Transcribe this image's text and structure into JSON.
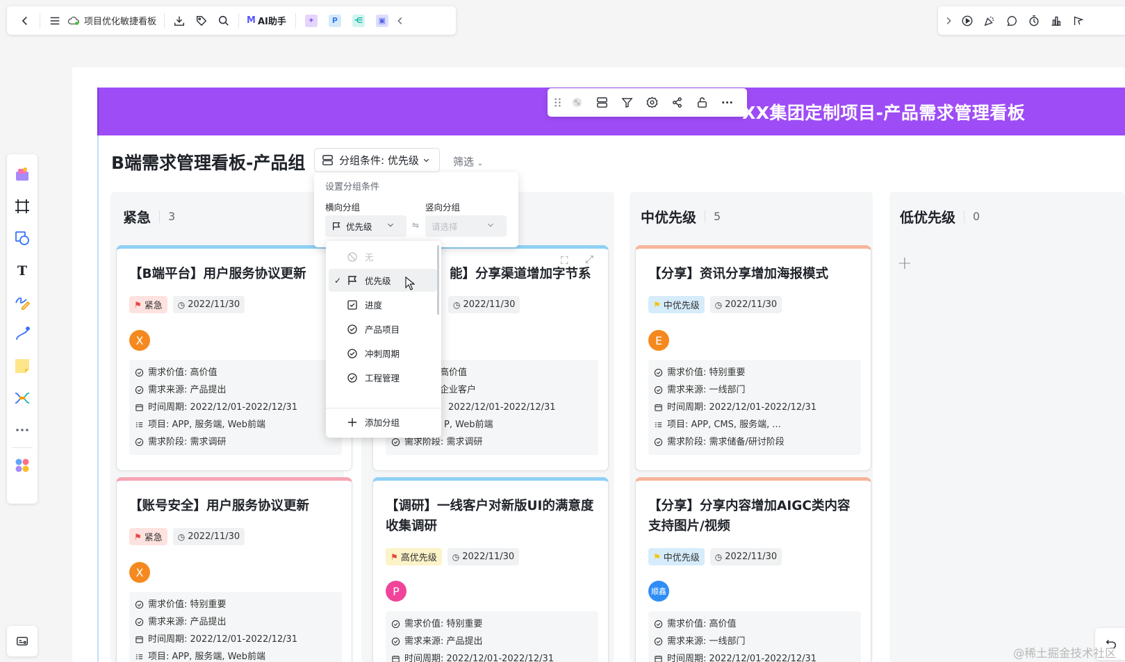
{
  "toolbar": {
    "doc_title": "项目优化敏捷看板",
    "ai_label": "AI助手"
  },
  "banner": {
    "title": "XX集团定制项目-产品需求管理看板"
  },
  "board": {
    "title": "B端需求管理看板-产品组",
    "group_label": "分组条件: 优先级",
    "filter_label": "筛选"
  },
  "group_dropdown": {
    "header": "设置分组条件",
    "horizontal_label": "横向分组",
    "vertical_label": "竖向分组",
    "horizontal_value": "优先级",
    "vertical_placeholder": "请选择"
  },
  "menu": {
    "items": [
      "无",
      "优先级",
      "进度",
      "产品项目",
      "冲刺周期",
      "工程管理"
    ],
    "add_label": "添加分组"
  },
  "columns": [
    {
      "title": "紧急",
      "count": "3"
    },
    {
      "title": "中优先级",
      "count": "5"
    },
    {
      "title": "低优先级",
      "count": "0"
    }
  ],
  "cards": [
    {
      "title": "【B端平台】用户服务协议更新",
      "priority": "紧急",
      "date": "2022/11/30",
      "avatar": "X",
      "props": [
        "需求价值: 高价值",
        "需求来源: 产品提出",
        "时间周期: 2022/12/01-2022/12/31",
        "项目: APP, 服务端, Web前端",
        "需求阶段: 需求调研"
      ]
    },
    {
      "title": "能】分享渠道增加字节系",
      "date": "2022/11/30",
      "props": [
        "高价值",
        "企业客户",
        "2022/12/01-2022/12/31",
        "P, Web前端",
        "需求阶段: 需求调研"
      ]
    },
    {
      "title": "【分享】资讯分享增加海报模式",
      "priority": "中优先级",
      "date": "2022/11/30",
      "avatar": "E",
      "props": [
        "需求价值: 特别重要",
        "需求来源: 一线部门",
        "时间周期: 2022/12/01-2022/12/31",
        "项目: APP, CMS, 服务端, ...",
        "需求阶段: 需求储备/研讨阶段"
      ]
    },
    {
      "title": "【账号安全】用户服务协议更新",
      "priority": "紧急",
      "date": "2022/11/30",
      "avatar": "X",
      "props": [
        "需求价值: 特别重要",
        "需求来源: 产品提出",
        "时间周期: 2022/12/01-2022/12/31",
        "项目: APP, 服务端, Web前端"
      ]
    },
    {
      "title": "【调研】一线客户对新版UI的满意度收集调研",
      "priority": "高优先级",
      "date": "2022/11/30",
      "avatar": "P",
      "props": [
        "需求价值: 特别重要",
        "需求来源: 产品提出",
        "时间周期: 2022/12/01-2022/12/31"
      ]
    },
    {
      "title": "【分享】分享内容增加AIGC类内容支持图片/视频",
      "priority": "中优先级",
      "date": "2022/11/30",
      "avatar": "顺鑫",
      "props": [
        "需求价值: 高价值",
        "需求来源: 一线部门",
        "时间周期: 2022/12/01-2022/12/31"
      ]
    }
  ],
  "watermark": "@稀土掘金技术社区",
  "colors": {
    "banner": "#9e4cf6",
    "urgent": "#e8453c",
    "medium": "#f5c400",
    "high": "#f0a020",
    "avatar_x": "#f5891f",
    "avatar_p": "#f0449a",
    "avatar_s": "#2f8ef5"
  }
}
